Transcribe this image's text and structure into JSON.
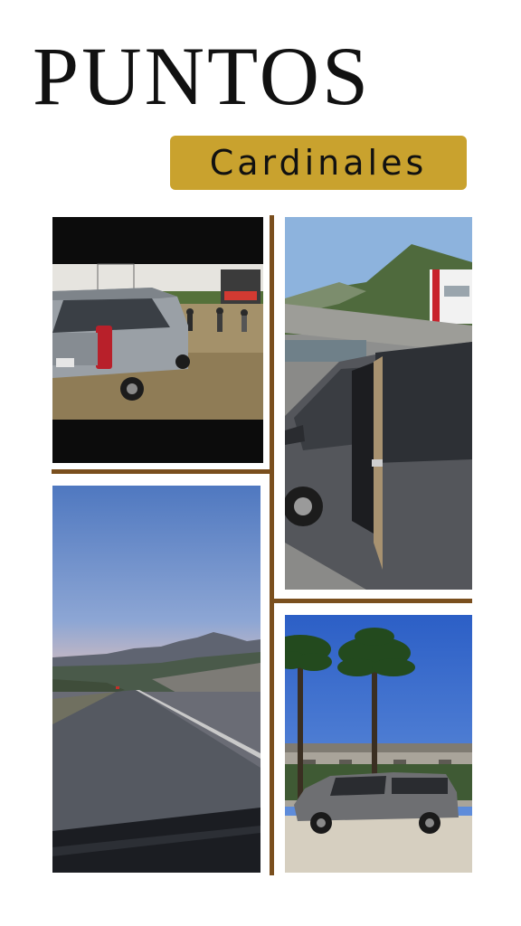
{
  "header": {
    "title": "PUNTOS",
    "subtitle": "Cardinales"
  },
  "colors": {
    "badge": "#c9a22e",
    "divider": "#7a4f1e",
    "text": "#111111"
  },
  "photos": [
    {
      "id": "van-at-concert-field"
    },
    {
      "id": "van-open-sliding-door"
    },
    {
      "id": "mountain-road-at-dusk"
    },
    {
      "id": "van-under-palm-trees"
    }
  ]
}
